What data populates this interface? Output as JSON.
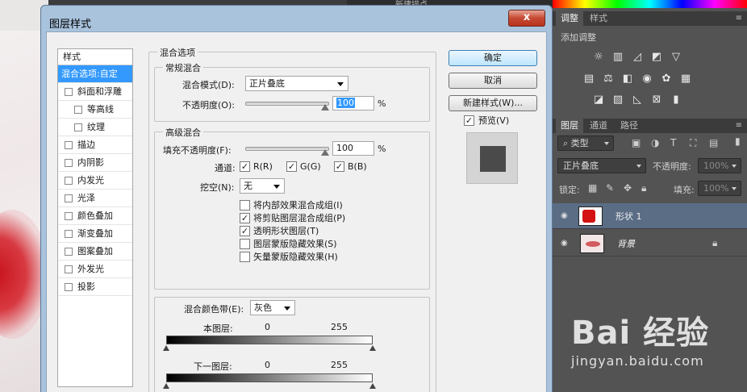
{
  "dialog": {
    "title": "图层样式",
    "close_label": "x"
  },
  "styles": {
    "header": "样式",
    "items": [
      {
        "label": "混合选项:自定",
        "selected": true,
        "checkbox": false,
        "sub": false
      },
      {
        "label": "斜面和浮雕",
        "checkbox": true,
        "sub": false
      },
      {
        "label": "等高线",
        "checkbox": true,
        "sub": true
      },
      {
        "label": "纹理",
        "checkbox": true,
        "sub": true
      },
      {
        "label": "描边",
        "checkbox": true,
        "sub": false
      },
      {
        "label": "内阴影",
        "checkbox": true,
        "sub": false
      },
      {
        "label": "内发光",
        "checkbox": true,
        "sub": false
      },
      {
        "label": "光泽",
        "checkbox": true,
        "sub": false
      },
      {
        "label": "颜色叠加",
        "checkbox": true,
        "sub": false
      },
      {
        "label": "渐变叠加",
        "checkbox": true,
        "sub": false
      },
      {
        "label": "图案叠加",
        "checkbox": true,
        "sub": false
      },
      {
        "label": "外发光",
        "checkbox": true,
        "sub": false
      },
      {
        "label": "投影",
        "checkbox": true,
        "sub": false
      }
    ]
  },
  "buttons": {
    "ok": "确定",
    "cancel": "取消",
    "new_style": "新建样式(W)...",
    "preview": "预览(V)",
    "check": "✓"
  },
  "blend_options": {
    "title": "混合选项",
    "general": {
      "title": "常规混合",
      "mode_label": "混合模式(D):",
      "mode_value": "正片叠底",
      "opacity_label": "不透明度(O):",
      "opacity_value": "100",
      "percent": "%"
    },
    "advanced": {
      "title": "高级混合",
      "fill_label": "填充不透明度(F):",
      "fill_value": "100",
      "percent": "%",
      "channels_label": "通道:",
      "channel_r": "R(R)",
      "channel_g": "G(G)",
      "channel_b": "B(B)",
      "knockout_label": "挖空(N):",
      "knockout_value": "无",
      "options": [
        {
          "label": "将内部效果混合成组(I)",
          "checked": false
        },
        {
          "label": "将剪贴图层混合成组(P)",
          "checked": true
        },
        {
          "label": "透明形状图层(T)",
          "checked": true
        },
        {
          "label": "图层蒙版隐藏效果(S)",
          "checked": false
        },
        {
          "label": "矢量蒙版隐藏效果(H)",
          "checked": false
        }
      ]
    },
    "blend_if": {
      "label": "混合颜色带(E):",
      "value": "灰色",
      "this_layer": "本图层:",
      "underlying": "下一图层:",
      "min": "0",
      "max": "255"
    }
  },
  "panel": {
    "top_label": "新建描点",
    "adjust_tabs": [
      "调整",
      "样式"
    ],
    "adjust_hint": "添加调整",
    "layer_tabs": [
      "图层",
      "通道",
      "路径"
    ],
    "filter_kind": "类型",
    "blend_mode": "正片叠底",
    "opacity_label": "不透明度:",
    "opacity_value": "100%",
    "lock_label": "锁定:",
    "fill_label": "填充:",
    "fill_value": "100%",
    "layers": [
      {
        "name": "形状 1",
        "selected": true
      },
      {
        "name": "背景",
        "selected": false
      }
    ]
  },
  "watermark": {
    "logo": "Bai 经验",
    "url": "jingyan.baidu.com"
  },
  "colors": {
    "accent": "#3399ff",
    "title_bar": "#a9c3dd",
    "panel_bg": "#535353"
  }
}
